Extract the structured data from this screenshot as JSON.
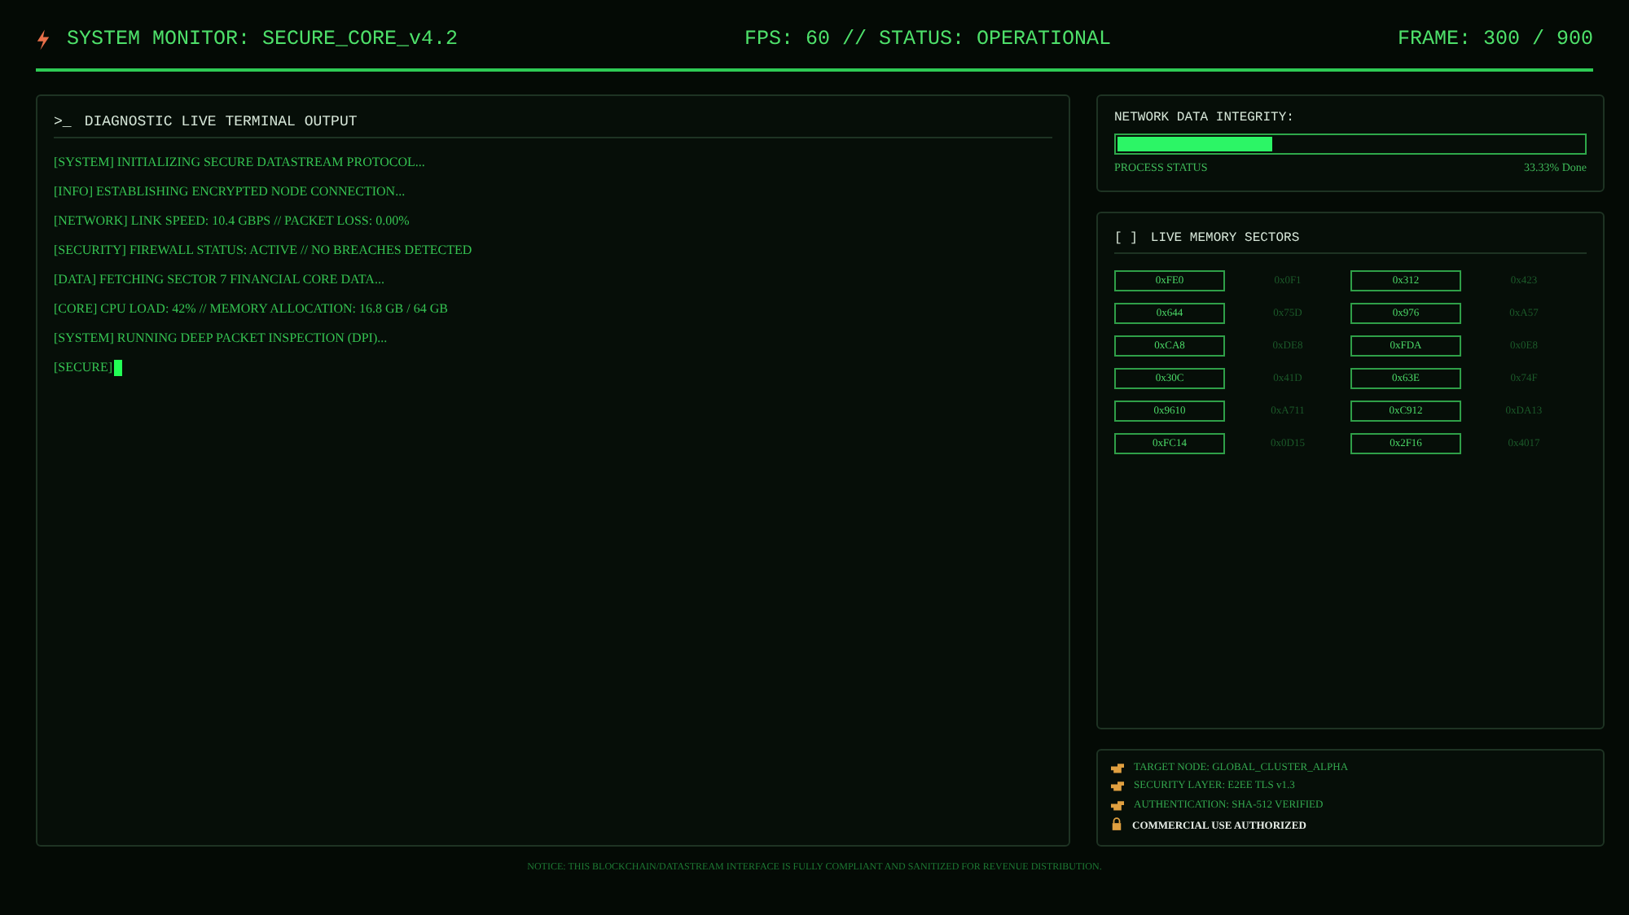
{
  "header": {
    "title": "SYSTEM MONITOR: SECURE_CORE_v4.2",
    "status": "FPS: 60 // STATUS: OPERATIONAL",
    "frame": "FRAME: 300 / 900"
  },
  "terminal": {
    "prompt": ">_",
    "title": "DIAGNOSTIC LIVE TERMINAL OUTPUT",
    "lines": [
      "[SYSTEM] INITIALIZING SECURE DATASTREAM PROTOCOL...",
      "[INFO] ESTABLISHING ENCRYPTED NODE CONNECTION...",
      "[NETWORK] LINK SPEED: 10.4 GBPS // PACKET LOSS: 0.00%",
      "[SECURITY] FIREWALL STATUS: ACTIVE // NO BREACHES DETECTED",
      "[DATA] FETCHING SECTOR 7 FINANCIAL CORE DATA...",
      "[CORE] CPU LOAD: 42% // MEMORY ALLOCATION: 16.8 GB / 64 GB",
      "[SYSTEM] RUNNING DEEP PACKET INSPECTION (DPI)..."
    ],
    "input": "[SECURE]",
    "cursor": true
  },
  "integrity": {
    "title": "NETWORK DATA INTEGRITY:",
    "level": 0.3333,
    "label": "PROCESS STATUS",
    "reading": "33.33% Done"
  },
  "memory": {
    "icon": "[ ]",
    "title": "LIVE MEMORY SECTORS",
    "sectors": [
      {
        "label": "0xFE0",
        "active": true
      },
      {
        "label": "0x0F1",
        "active": false
      },
      {
        "label": "0x312",
        "active": true
      },
      {
        "label": "0x423",
        "active": false
      },
      {
        "label": "0x644",
        "active": true
      },
      {
        "label": "0x75D",
        "active": false
      },
      {
        "label": "0x976",
        "active": true
      },
      {
        "label": "0xA57",
        "active": false
      },
      {
        "label": "0xCA8",
        "active": true
      },
      {
        "label": "0xDE8",
        "active": false
      },
      {
        "label": "0xFDA",
        "active": true
      },
      {
        "label": "0x0E8",
        "active": false
      },
      {
        "label": "0x30C",
        "active": true
      },
      {
        "label": "0x41D",
        "active": false
      },
      {
        "label": "0x63E",
        "active": true
      },
      {
        "label": "0x74F",
        "active": false
      },
      {
        "label": "0x9610",
        "active": true
      },
      {
        "label": "0xA711",
        "active": false
      },
      {
        "label": "0xC912",
        "active": true
      },
      {
        "label": "0xDA13",
        "active": false
      },
      {
        "label": "0xFC14",
        "active": true
      },
      {
        "label": "0x0D15",
        "active": false
      },
      {
        "label": "0x2F16",
        "active": true
      },
      {
        "label": "0x4017",
        "active": false
      }
    ]
  },
  "info": [
    {
      "kind": "pointer",
      "text": "TARGET NODE: GLOBAL_CLUSTER_ALPHA"
    },
    {
      "kind": "pointer",
      "text": "SECURITY LAYER: E2EE TLS v1.3"
    },
    {
      "kind": "pointer",
      "text": "AUTHENTICATION: SHA-512 VERIFIED"
    },
    {
      "kind": "lock",
      "text": "COMMERCIAL USE AUTHORIZED"
    }
  ],
  "notice": "NOTICE: THIS BLOCKCHAIN/DATASTREAM INTERFACE IS FULLY COMPLIANT AND SANITIZED FOR REVENUE DISTRIBUTION."
}
